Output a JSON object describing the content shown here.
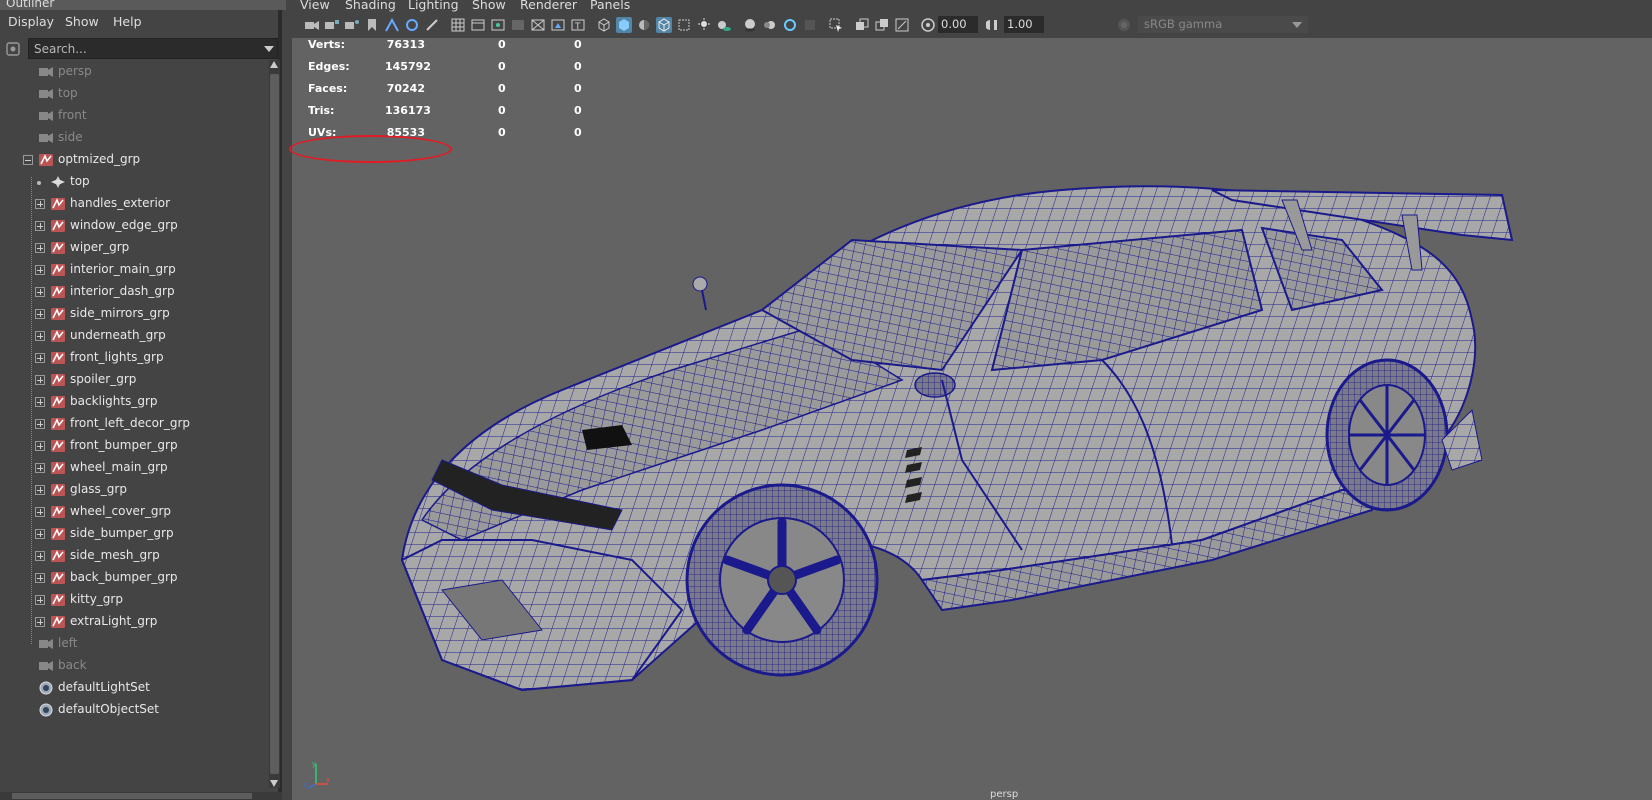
{
  "outliner": {
    "title": "Outliner",
    "menu": [
      "Display",
      "Show",
      "Help"
    ],
    "search_placeholder": "Search...",
    "items": [
      {
        "label": "persp",
        "type": "camera",
        "style": "dim",
        "indent": 0
      },
      {
        "label": "top",
        "type": "camera",
        "style": "dim",
        "indent": 0
      },
      {
        "label": "front",
        "type": "camera",
        "style": "dim",
        "indent": 0
      },
      {
        "label": "side",
        "type": "camera",
        "style": "dim",
        "indent": 0
      },
      {
        "label": "optmized_grp",
        "type": "group",
        "style": "bright",
        "indent": 0,
        "expander": "minus"
      },
      {
        "label": "top",
        "type": "transform",
        "style": "bright",
        "indent": 1
      },
      {
        "label": "handles_exterior",
        "type": "group",
        "style": "bright",
        "indent": 1,
        "expander": "plus"
      },
      {
        "label": "window_edge_grp",
        "type": "group",
        "style": "bright",
        "indent": 1,
        "expander": "plus"
      },
      {
        "label": "wiper_grp",
        "type": "group",
        "style": "bright",
        "indent": 1,
        "expander": "plus"
      },
      {
        "label": "interior_main_grp",
        "type": "group",
        "style": "bright",
        "indent": 1,
        "expander": "plus"
      },
      {
        "label": "interior_dash_grp",
        "type": "group",
        "style": "bright",
        "indent": 1,
        "expander": "plus"
      },
      {
        "label": "side_mirrors_grp",
        "type": "group",
        "style": "bright",
        "indent": 1,
        "expander": "plus"
      },
      {
        "label": "underneath_grp",
        "type": "group",
        "style": "bright",
        "indent": 1,
        "expander": "plus"
      },
      {
        "label": "front_lights_grp",
        "type": "group",
        "style": "bright",
        "indent": 1,
        "expander": "plus"
      },
      {
        "label": "spoiler_grp",
        "type": "group",
        "style": "bright",
        "indent": 1,
        "expander": "plus"
      },
      {
        "label": "backlights_grp",
        "type": "group",
        "style": "bright",
        "indent": 1,
        "expander": "plus"
      },
      {
        "label": "front_left_decor_grp",
        "type": "group",
        "style": "bright",
        "indent": 1,
        "expander": "plus"
      },
      {
        "label": "front_bumper_grp",
        "type": "group",
        "style": "bright",
        "indent": 1,
        "expander": "plus"
      },
      {
        "label": "wheel_main_grp",
        "type": "group",
        "style": "bright",
        "indent": 1,
        "expander": "plus"
      },
      {
        "label": "glass_grp",
        "type": "group",
        "style": "bright",
        "indent": 1,
        "expander": "plus"
      },
      {
        "label": "wheel_cover_grp",
        "type": "group",
        "style": "bright",
        "indent": 1,
        "expander": "plus"
      },
      {
        "label": "side_bumper_grp",
        "type": "group",
        "style": "bright",
        "indent": 1,
        "expander": "plus"
      },
      {
        "label": "side_mesh_grp",
        "type": "group",
        "style": "bright",
        "indent": 1,
        "expander": "plus"
      },
      {
        "label": "back_bumper_grp",
        "type": "group",
        "style": "bright",
        "indent": 1,
        "expander": "plus"
      },
      {
        "label": "kitty_grp",
        "type": "group",
        "style": "bright",
        "indent": 1,
        "expander": "plus"
      },
      {
        "label": "extraLight_grp",
        "type": "group",
        "style": "bright",
        "indent": 1,
        "expander": "plus"
      },
      {
        "label": "left",
        "type": "camera",
        "style": "dim",
        "indent": 0
      },
      {
        "label": "back",
        "type": "camera",
        "style": "dim",
        "indent": 0
      },
      {
        "label": "defaultLightSet",
        "type": "set",
        "style": "bright",
        "indent": 0
      },
      {
        "label": "defaultObjectSet",
        "type": "set",
        "style": "bright",
        "indent": 0
      }
    ]
  },
  "viewport": {
    "menu": [
      "View",
      "Shading",
      "Lighting",
      "Show",
      "Renderer",
      "Panels"
    ],
    "exposure": "0.00",
    "gamma": "1.00",
    "color_space": "sRGB gamma",
    "camera_label": "persp",
    "hud": [
      {
        "label": "Verts:",
        "value": "76313",
        "c2": "0",
        "c3": "0"
      },
      {
        "label": "Edges:",
        "value": "145792",
        "c2": "0",
        "c3": "0"
      },
      {
        "label": "Faces:",
        "value": "70242",
        "c2": "0",
        "c3": "0"
      },
      {
        "label": "Tris:",
        "value": "136173",
        "c2": "0",
        "c3": "0"
      },
      {
        "label": "UVs:",
        "value": "85533",
        "c2": "0",
        "c3": "0"
      }
    ],
    "highlight_color": "#e21b24",
    "wireframe_color": "#1a1a8c"
  }
}
